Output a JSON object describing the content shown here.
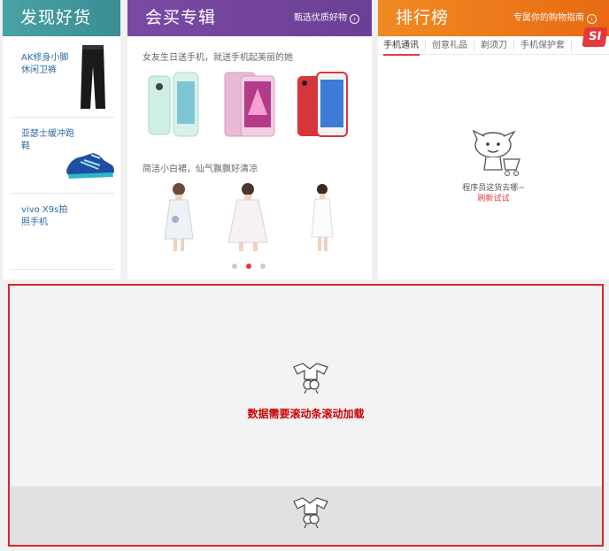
{
  "discover": {
    "title": "发现好货",
    "items": [
      {
        "name": "AK修身小脚休闲卫裤"
      },
      {
        "name": "亚瑟士缓冲跑鞋"
      },
      {
        "name": "vivo X9s拍照手机"
      }
    ]
  },
  "album": {
    "title": "会买专辑",
    "more": "甄选优质好物",
    "caption1": "女友生日送手机，就送手机起美丽的她",
    "caption2": "简洁小白裙，仙气飘飘好清凉",
    "dots": 3,
    "active_dot": 1
  },
  "ranking": {
    "title": "排行榜",
    "more": "专属你的购物指南",
    "tabs": [
      "手机通讯",
      "创意礼品",
      "剃须刀",
      "手机保护套"
    ],
    "active_tab": 0,
    "badge": "SI",
    "message": "程序员这货去哪~",
    "link": "刷新试试"
  },
  "lazy": {
    "message": "数据需要滚动条滚动加载"
  },
  "colors": {
    "accent_red": "#e4393c",
    "teal": "#49a2a5",
    "purple": "#7a4aa3",
    "orange": "#f08a22"
  }
}
